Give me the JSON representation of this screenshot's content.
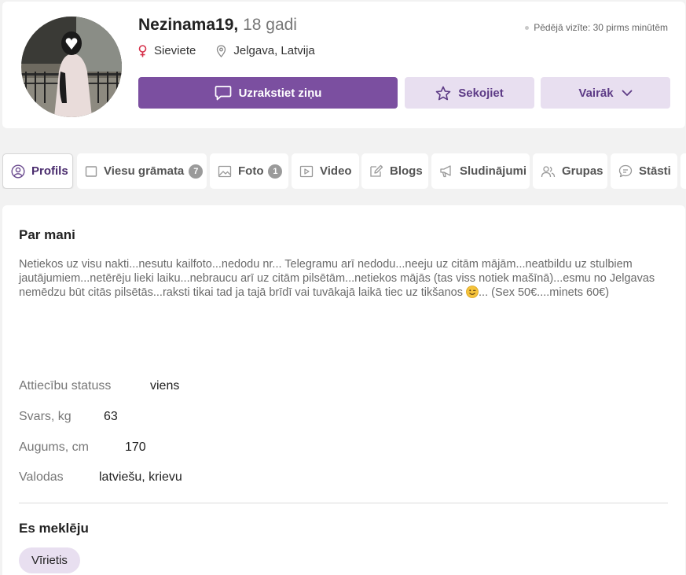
{
  "profile": {
    "username": "Nezinama19,",
    "age": "18 gadi",
    "last_visit": "Pēdējā vizīte: 30 pirms minūtēm",
    "gender": "Sieviete",
    "location": "Jelgava, Latvija"
  },
  "actions": {
    "message": "Uzrakstiet ziņu",
    "follow": "Sekojiet",
    "more": "Vairāk"
  },
  "tabs": [
    {
      "label": "Profils",
      "icon": "user-circle-icon",
      "active": true
    },
    {
      "label": "Viesu grāmata",
      "icon": "book-icon",
      "badge": "7"
    },
    {
      "label": "Foto",
      "icon": "image-icon",
      "badge": "1"
    },
    {
      "label": "Video",
      "icon": "video-icon"
    },
    {
      "label": "Blogs",
      "icon": "pencil-icon"
    },
    {
      "label": "Sludinājumi",
      "icon": "megaphone-icon"
    },
    {
      "label": "Grupas",
      "icon": "users-icon"
    },
    {
      "label": "Stāsti",
      "icon": "chat-icon"
    }
  ],
  "about": {
    "title": "Par mani",
    "text": "Netiekos uz visu nakti...nesutu kailfoto...nedodu nr... Telegramu arī nedodu...neeju uz citām mājām...neatbildu uz stulbiem jautājumiem...netērēju lieki laiku...nebraucu arī uz citām pilsētām...netiekos mājās (tas viss notiek mašīnā)...esmu no Jelgavas nemēdzu būt citās pilsētās...raksti tikai tad ja tajā brīdī vai tuvākajā laikā tiec uz tikšanos",
    "text_end": "... (Sex 50€....minets 60€)"
  },
  "details": [
    {
      "label": "Attiecību statuss",
      "value": "viens"
    },
    {
      "label": "Svars, kg",
      "value": "63"
    },
    {
      "label": "Augums, cm",
      "value": "170"
    },
    {
      "label": "Valodas",
      "value": "latviešu, krievu"
    }
  ],
  "looking_for": {
    "title": "Es meklēju",
    "chip": "Vīrietis"
  },
  "colors": {
    "accent": "#7b4fa0",
    "accent_light": "#e8dff0",
    "female_icon": "#d6304a"
  }
}
